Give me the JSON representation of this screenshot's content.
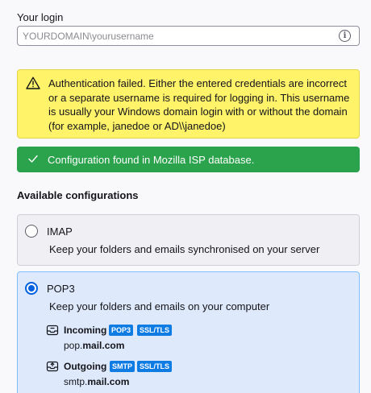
{
  "login": {
    "label": "Your login",
    "placeholder": "YOURDOMAIN\\yourusername",
    "value": ""
  },
  "warning": {
    "icon": "warning-triangle-icon",
    "text": "Authentication failed. Either the entered credentials are incorrect or a separate username is required for logging in. This username is usually your Windows domain login with or without the domain (for example, janedoe or AD\\\\janedoe)"
  },
  "success": {
    "icon": "checkmark-icon",
    "text": "Configuration found in Mozilla ISP database."
  },
  "available": {
    "heading": "Available configurations",
    "configs": [
      {
        "title": "IMAP",
        "description": "Keep your folders and emails synchronised on your server",
        "selected": false
      },
      {
        "title": "POP3",
        "description": "Keep your folders and emails on your computer",
        "selected": true,
        "incoming": {
          "label": "Incoming",
          "badges": [
            "POP3",
            "SSL/TLS"
          ],
          "host_prefix": "pop.",
          "host_domain": "mail.com"
        },
        "outgoing": {
          "label": "Outgoing",
          "badges": [
            "SMTP",
            "SSL/TLS"
          ],
          "host_prefix": "smtp.",
          "host_domain": "mail.com"
        }
      }
    ]
  },
  "colors": {
    "warning_bg": "#fff36a",
    "success_bg": "#2ba24c",
    "selected_card_bg": "#deeafc",
    "accent": "#0060df",
    "badge": "#0f7ce4"
  }
}
